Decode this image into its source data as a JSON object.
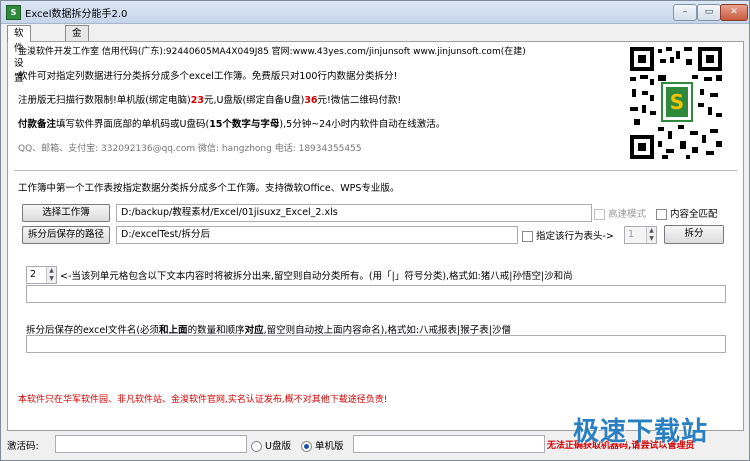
{
  "window": {
    "title": "Excel数据拆分能手2.0",
    "controls": {
      "minimize": "–",
      "restore": "▭",
      "close": "✕"
    }
  },
  "tabs": [
    {
      "label": "软件设置"
    },
    {
      "label": "金浚软件"
    }
  ],
  "info": {
    "line1": "金浚软件开发工作室 信用代码(广东):92440605MA4X049J85 官网:www.43yes.com/jinjunsoft  www.jinjunsoft.com(在建)",
    "line2": "软件可对指定列数据进行分类拆分成多个excel工作簿。免费版只对100行内数据分类拆分!",
    "line3_a": "注册版无扫描行数限制!单机版(绑定电脑)",
    "line3_b": "23",
    "line3_c": "元,U盘版(绑定自备U盘)",
    "line3_d": "36",
    "line3_e": "元!微信二维码付款!",
    "line4_a": "付款备注",
    "line4_b": "填写软件界面底部的单机码或U盘码(",
    "line4_c": "15个数字与字母",
    "line4_d": "),5分钟~24小时内软件自动在线激活。",
    "line5": "QQ、邮箱、支付宝: 332092136@qq.com    微信: hangzhong    电话: 18934355455"
  },
  "qr_icon": "wechat-qr-code",
  "section_title": "工作簿中第一个工作表按指定数据分类拆分成多个工作簿。支持微软Office、WPS专业版。",
  "select_workbook": {
    "button": "选择工作簿",
    "path": "D:/backup/教程素材/Excel/01jisuxz_Excel_2.xls"
  },
  "high_speed": {
    "label": "高速模式",
    "checked": false,
    "enabled": false
  },
  "full_match": {
    "label": "内容全匹配",
    "checked": false
  },
  "save_path": {
    "button": "拆分后保存的路径",
    "path": "D:/excelTest/拆分后"
  },
  "header_row": {
    "label": "指定该行为表头->",
    "checked": false,
    "value": "1"
  },
  "split_button": "拆分",
  "column": {
    "value": "2",
    "hint": "<-当该列单元格包含以下文本内容时将被拆分出来,留空则自动分类所有。(用「|」符号分类),格式如:猪八戒|孙悟空|沙和尚",
    "input": ""
  },
  "filename": {
    "hint_a": "拆分后保存的excel文件名(必须",
    "hint_b": "和上面",
    "hint_c": "的数量和顺序",
    "hint_d": "对应",
    "hint_e": ",留空则自动按上面内容命名),格式如:八戒报表|猴子表|沙僧",
    "input": ""
  },
  "notice": "本软件只在华军软件园、非凡软件站、金浚软件官网,实名认证发布,概不对其他下载途径负责!",
  "status": {
    "activation_label": "激活码:",
    "activation_value": "",
    "usb_label": "U盘版",
    "single_label": "单机版",
    "selected": "single",
    "machine_code": "",
    "warning": "无法正确获取机器码,请尝试以管理员"
  },
  "watermark": "极速下载站",
  "colors": {
    "red": "#d40000",
    "accent": "#2a7fc0"
  }
}
